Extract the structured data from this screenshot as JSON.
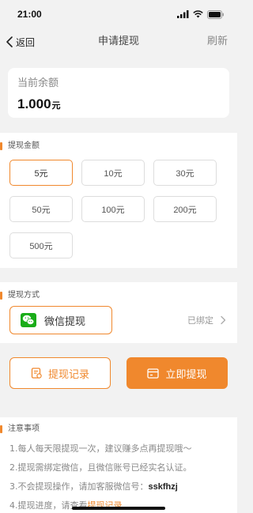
{
  "status_bar": {
    "time": "21:00"
  },
  "nav": {
    "back_label": "返回",
    "title": "申请提现",
    "refresh_label": "刷新"
  },
  "balance": {
    "label": "当前余额",
    "amount": "1.000",
    "unit": "元"
  },
  "amount_section": {
    "title": "提现金额",
    "options": [
      "5元",
      "10元",
      "30元",
      "50元",
      "100元",
      "200元",
      "500元"
    ],
    "selected": "5元"
  },
  "method_section": {
    "title": "提现方式",
    "method_label": "微信提现",
    "bind_status": "已绑定"
  },
  "actions": {
    "record_label": "提现记录",
    "withdraw_label": "立即提现"
  },
  "notes": {
    "title": "注意事项",
    "line1": "1.每人每天限提现一次，建议赚多点再提现哦～",
    "line2": "2.提现需绑定微信，且微信账号已经实名认证。",
    "line3_prefix": "3.不会提现操作，请加客服微信号：",
    "line3_wechat": "sskfhzj",
    "line4_prefix": "4.提现进度，请查看",
    "line4_link": "提现记录"
  },
  "colors": {
    "accent": "#f0882d",
    "wechat_green": "#1aad19",
    "background": "#f2f2f2"
  },
  "icons": {
    "back": "chevron-left-icon",
    "signal": "signal-icon",
    "wifi": "wifi-icon",
    "battery": "battery-icon",
    "wechat": "wechat-icon",
    "chevron": "chevron-right-icon",
    "record": "record-icon",
    "wallet": "wallet-icon"
  }
}
